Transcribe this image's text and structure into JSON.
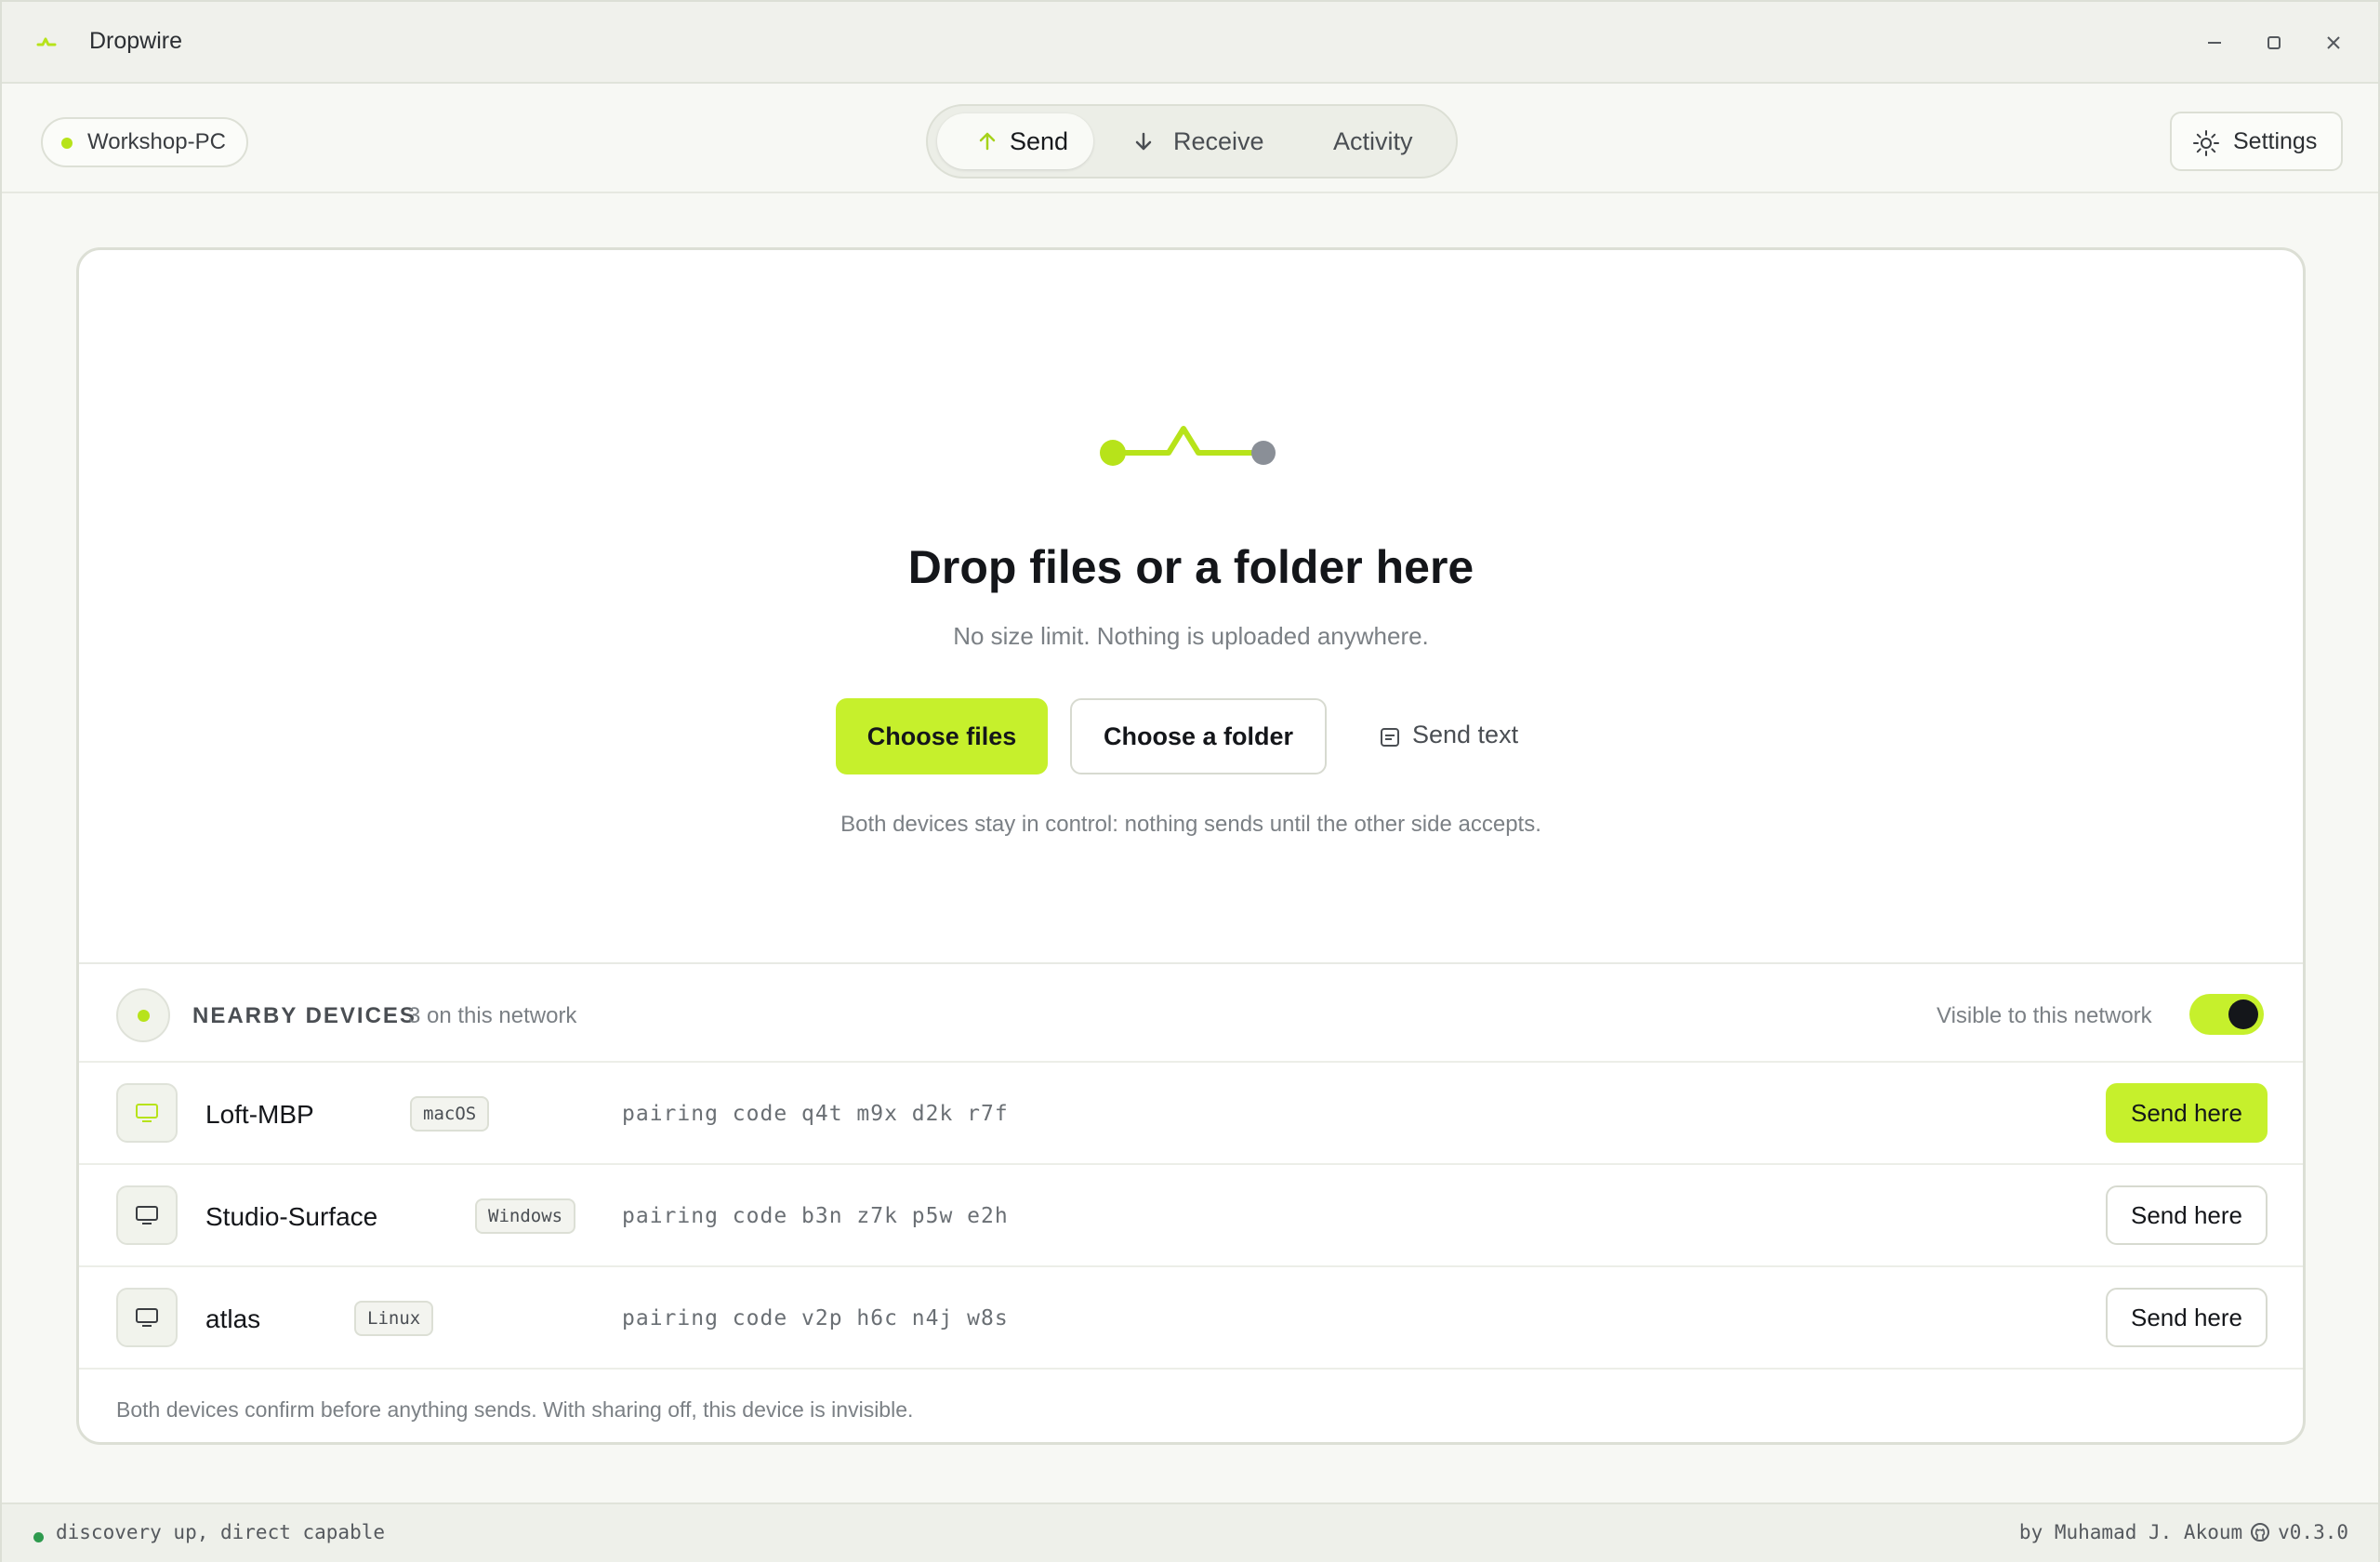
{
  "app": {
    "title": "Dropwire"
  },
  "device": {
    "name": "Workshop-PC"
  },
  "tabs": [
    {
      "label": "Send"
    },
    {
      "label": "Receive"
    },
    {
      "label": "Activity"
    }
  ],
  "settings": {
    "label": "Settings"
  },
  "hero": {
    "title": "Drop files or a folder here",
    "subtitle": "No size limit. Nothing is uploaded anywhere.",
    "choose_files": "Choose files",
    "choose_folder": "Choose a folder",
    "send_text": "Send text",
    "note": "Both devices stay in control: nothing sends until the other side accepts."
  },
  "nearby": {
    "title": "NEARBY DEVICES",
    "count": "3 on this network",
    "visible_label": "Visible to this network",
    "visible": true,
    "devices": [
      {
        "name": "Loft-MBP",
        "os": "macOS",
        "code": "pairing code q4t m9x d2k r7f",
        "action": "Send here"
      },
      {
        "name": "Studio-Surface",
        "os": "Windows",
        "code": "pairing code b3n z7k p5w e2h",
        "action": "Send here"
      },
      {
        "name": "atlas",
        "os": "Linux",
        "code": "pairing code v2p h6c n4j w8s",
        "action": "Send here"
      }
    ],
    "footer": "Both devices confirm before anything sends. With sharing off, this device is invisible."
  },
  "status": {
    "left": "discovery up, direct capable",
    "author": "by Muhamad J. Akoum",
    "version": "v0.3.0"
  },
  "colors": {
    "accent": "#c6f02c",
    "status_ok": "#2e9a4e",
    "dark": "#14161a"
  },
  "icons": [
    "dropwire-logo-icon",
    "minimize-icon",
    "maximize-icon",
    "close-icon",
    "arrow-up-icon",
    "arrow-down-icon",
    "gear-icon",
    "connection-icon",
    "note-icon",
    "radar-icon",
    "monitor-icon",
    "github-icon"
  ]
}
